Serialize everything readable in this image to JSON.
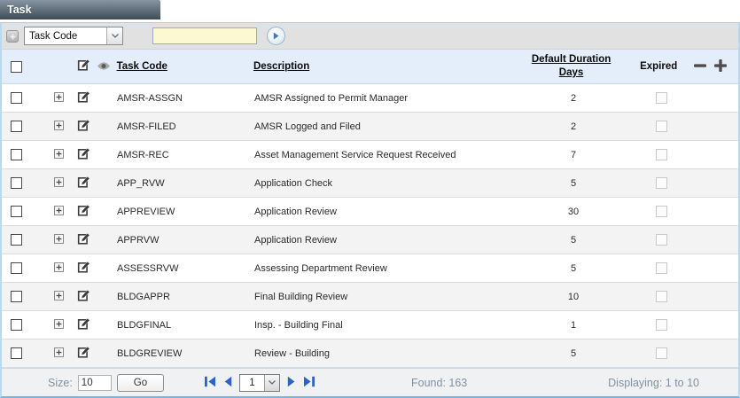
{
  "title": "Task",
  "toolbar": {
    "field_select_value": "Task Code",
    "search_value": ""
  },
  "icons": {
    "add_filter": "plus-square",
    "edit": "pencil-square",
    "view": "eye",
    "expand": "plus-box",
    "remove_column": "minus",
    "add_column": "plus",
    "go": "play-circle",
    "first_page": "bar-left-triangle",
    "prev_page": "left-triangle",
    "next_page": "right-triangle",
    "last_page": "bar-right-triangle",
    "dropdown": "chevron-down"
  },
  "table": {
    "header": {
      "task_code": "Task Code",
      "description": "Description",
      "duration_line1": "Default Duration",
      "duration_line2": "Days",
      "expired": "Expired"
    },
    "rows": [
      {
        "task_code": "AMSR-ASSGN",
        "description": "AMSR Assigned to Permit Manager",
        "duration": "2"
      },
      {
        "task_code": "AMSR-FILED",
        "description": "AMSR Logged and Filed",
        "duration": "2"
      },
      {
        "task_code": "AMSR-REC",
        "description": "Asset Management Service Request Received",
        "duration": "7"
      },
      {
        "task_code": "APP_RVW",
        "description": "Application Check",
        "duration": "5"
      },
      {
        "task_code": "APPREVIEW",
        "description": "Application Review",
        "duration": "30"
      },
      {
        "task_code": "APPRVW",
        "description": "Application Review",
        "duration": "5"
      },
      {
        "task_code": "ASSESSRVW",
        "description": "Assessing Department Review",
        "duration": "5"
      },
      {
        "task_code": "BLDGAPPR",
        "description": "Final Building Review",
        "duration": "10"
      },
      {
        "task_code": "BLDGFINAL",
        "description": "Insp. - Building Final",
        "duration": "1"
      },
      {
        "task_code": "BLDGREVIEW",
        "description": "Review - Building",
        "duration": "5"
      }
    ]
  },
  "footer": {
    "size_label": "Size:",
    "size_value": "10",
    "go_label": "Go",
    "page_value": "1",
    "found": "Found: 163",
    "displaying": "Displaying: 1 to 10"
  },
  "colors": {
    "title_bar_dark": "#3e4c58",
    "panel_border": "#b9d9f0",
    "header_bg": "#e3eefa",
    "row_alt_bg": "#f3f3f3",
    "toolbar_bg": "#e1e1e1",
    "search_bg": "#fcf8d2",
    "pagination_blue": "#2d62c6",
    "footer_text": "#8191a2"
  }
}
